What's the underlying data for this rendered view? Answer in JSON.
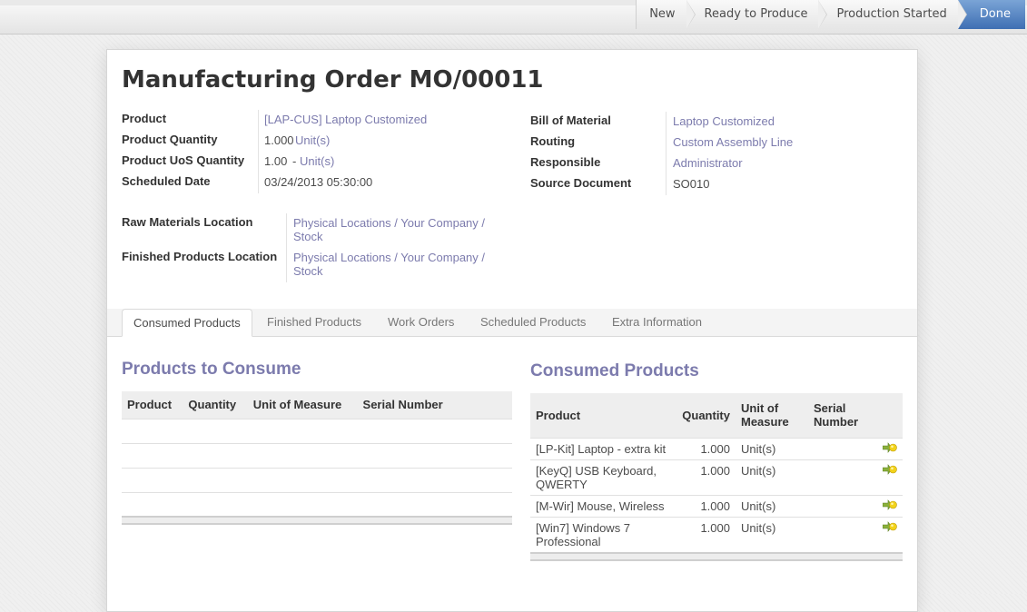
{
  "statusbar": {
    "stages": [
      {
        "label": "New",
        "active": false
      },
      {
        "label": "Ready to Produce",
        "active": false
      },
      {
        "label": "Production Started",
        "active": false
      },
      {
        "label": "Done",
        "active": true
      }
    ]
  },
  "form": {
    "title": "Manufacturing Order MO/00011",
    "left_fields": {
      "product_label": "Product",
      "product_value": "[LAP-CUS] Laptop Customized",
      "qty_label": "Product Quantity",
      "qty_value": "1.000",
      "qty_uom": "Unit(s)",
      "uos_label": "Product UoS Quantity",
      "uos_value": "1.00",
      "uos_sep": "-",
      "uos_uom": "Unit(s)",
      "date_label": "Scheduled Date",
      "date_value": "03/24/2013 05:30:00"
    },
    "right_fields": {
      "bom_label": "Bill of Material",
      "bom_value": "Laptop Customized",
      "routing_label": "Routing",
      "routing_value": "Custom Assembly Line",
      "responsible_label": "Responsible",
      "responsible_value": "Administrator",
      "source_label": "Source Document",
      "source_value": "SO010"
    },
    "locations": {
      "raw_label": "Raw Materials Location",
      "raw_value": "Physical Locations / Your Company / Stock",
      "finished_label": "Finished Products Location",
      "finished_value": "Physical Locations / Your Company / Stock"
    }
  },
  "tabs": [
    {
      "label": "Consumed Products",
      "active": true
    },
    {
      "label": "Finished Products",
      "active": false
    },
    {
      "label": "Work Orders",
      "active": false
    },
    {
      "label": "Scheduled Products",
      "active": false
    },
    {
      "label": "Extra Information",
      "active": false
    }
  ],
  "to_consume": {
    "title": "Products to Consume",
    "columns": [
      "Product",
      "Quantity",
      "Unit of Measure",
      "Serial Number"
    ],
    "rows": []
  },
  "consumed": {
    "title": "Consumed Products",
    "columns": [
      "Product",
      "Quantity",
      "Unit of Measure",
      "Serial Number"
    ],
    "rows": [
      {
        "product": "[LP-Kit] Laptop - extra kit",
        "quantity": "1.000",
        "uom": "Unit(s)",
        "serial": ""
      },
      {
        "product": "[KeyQ] USB Keyboard, QWERTY",
        "quantity": "1.000",
        "uom": "Unit(s)",
        "serial": ""
      },
      {
        "product": "[M-Wir] Mouse, Wireless",
        "quantity": "1.000",
        "uom": "Unit(s)",
        "serial": ""
      },
      {
        "product": "[Win7] Windows 7 Professional",
        "quantity": "1.000",
        "uom": "Unit(s)",
        "serial": ""
      }
    ]
  },
  "icons": {
    "stage_separator": "chevron-right-icon",
    "row_action": "move-product-icon"
  },
  "colors": {
    "link": "#7c7bad",
    "active_stage": "#4a78bb",
    "section_title": "#7c7bad"
  }
}
